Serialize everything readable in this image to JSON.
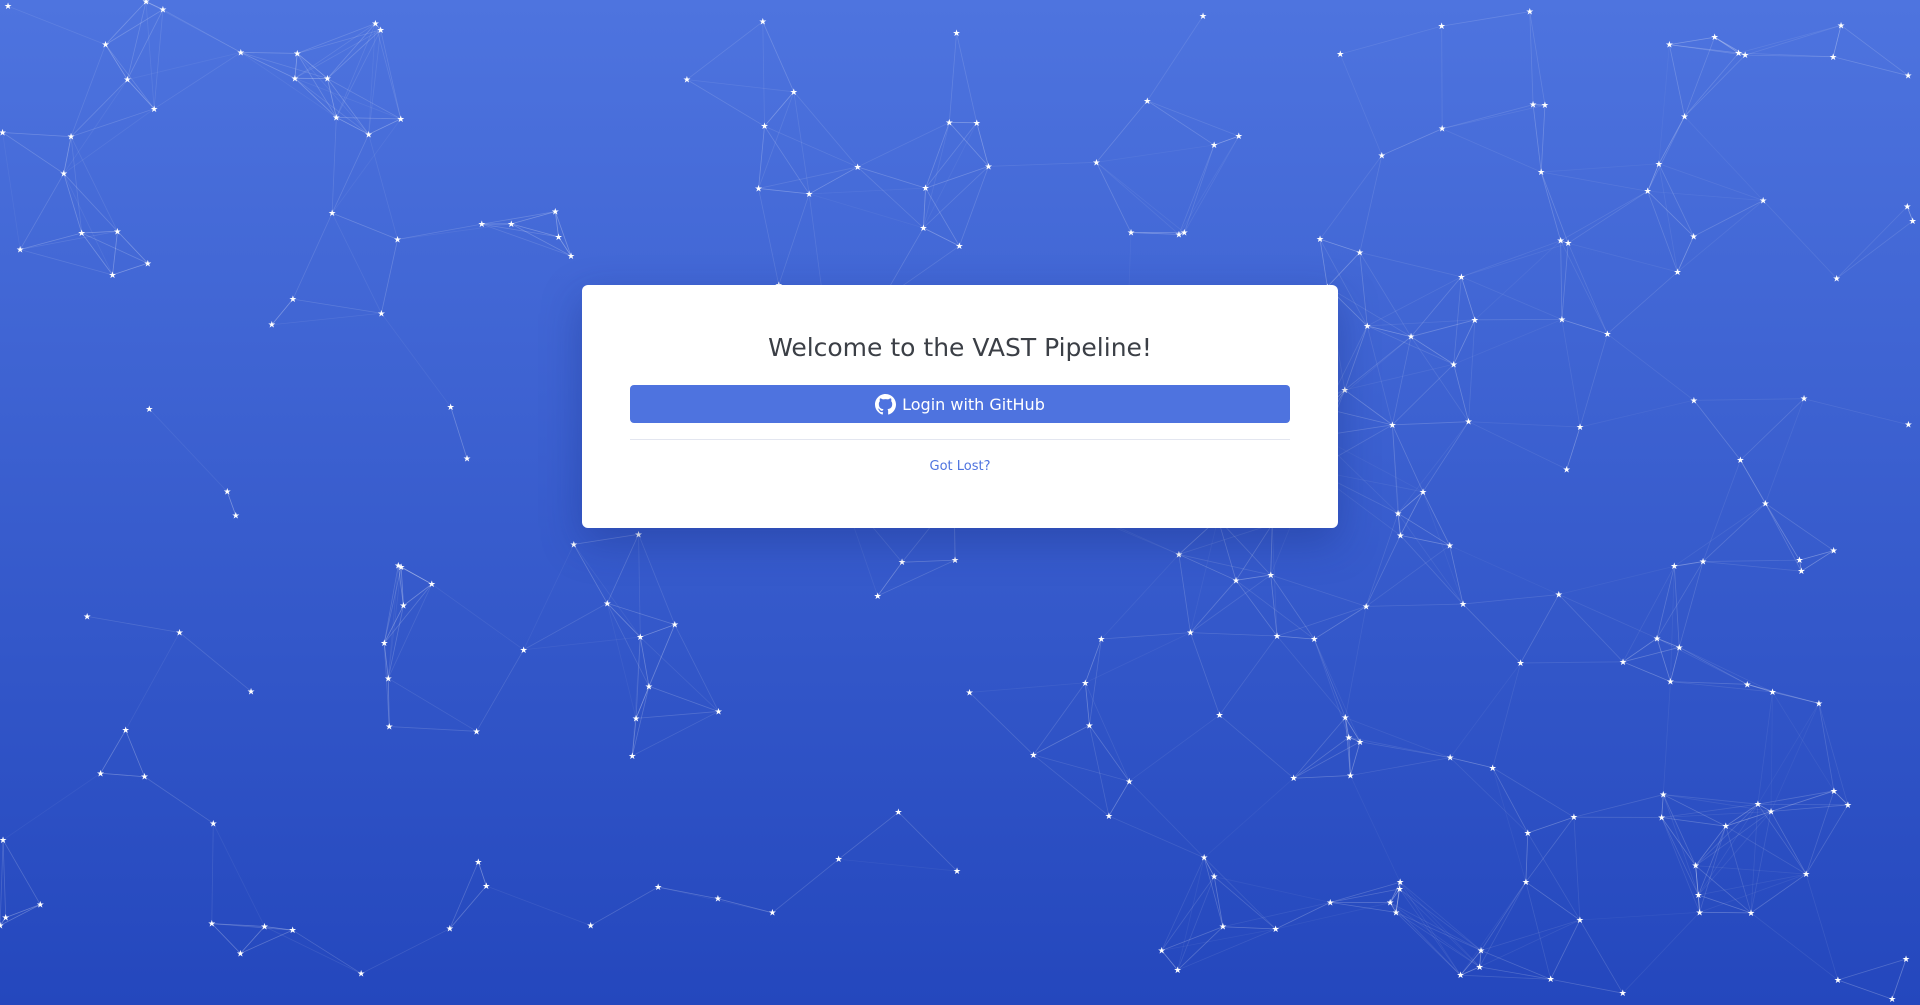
{
  "page": {
    "background_top": "#4e74df",
    "background_bottom": "#2447bd"
  },
  "login": {
    "title": "Welcome to the VAST Pipeline!",
    "github_button_label": "Login with GitHub",
    "github_icon": "github-icon",
    "accent": "#4e73df",
    "lost_link_label": "Got Lost?"
  },
  "background": {
    "style": "particle-network",
    "node_icon": "star-icon",
    "line_color": "#ffffff"
  }
}
